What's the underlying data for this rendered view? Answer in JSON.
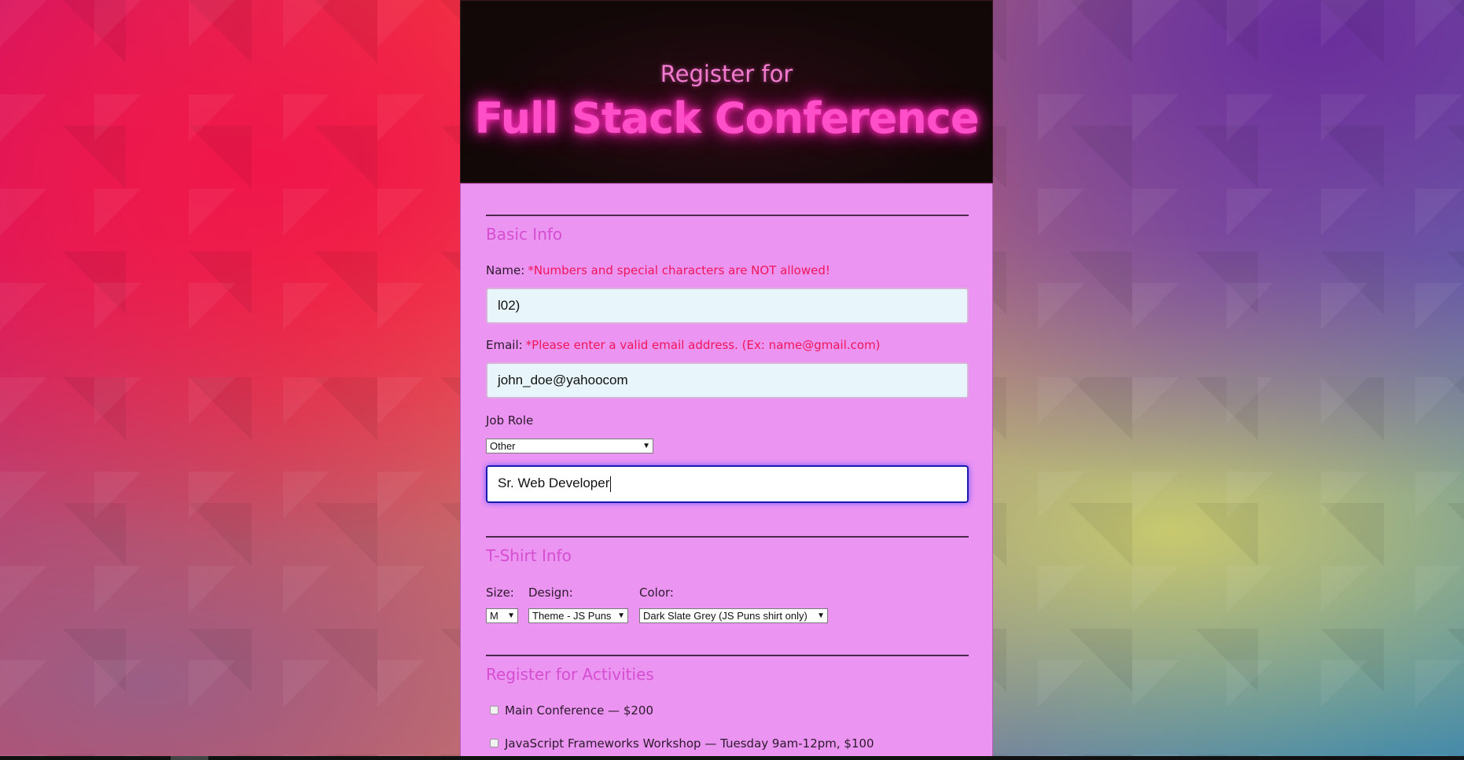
{
  "header": {
    "subtitle": "Register for",
    "title": "Full Stack Conference"
  },
  "basic_info": {
    "title": "Basic Info",
    "name_label": "Name:",
    "name_error": "*Numbers and special characters are NOT allowed!",
    "name_value": "l02)",
    "email_label": "Email:",
    "email_error": "*Please enter a valid email address. (Ex: name@gmail.com)",
    "email_value": "john_doe@yahoocom",
    "job_role_label": "Job Role",
    "job_role_selected": "Other",
    "other_title_value": "Sr. Web Developer"
  },
  "tshirt": {
    "title": "T-Shirt Info",
    "size_label": "Size:",
    "size_selected": "M",
    "design_label": "Design:",
    "design_selected": "Theme - JS Puns",
    "color_label": "Color:",
    "color_selected": "Dark Slate Grey (JS Puns shirt only)"
  },
  "activities": {
    "title": "Register for Activities",
    "items": [
      {
        "label": "Main Conference — $200",
        "checked": false
      },
      {
        "label": "JavaScript Frameworks Workshop — Tuesday 9am-12pm, $100",
        "checked": false
      }
    ]
  },
  "colors": {
    "form_background": "#ec94f2",
    "accent": "#d54ed2",
    "error": "#f0165a",
    "focus_border": "#1a1ab0"
  }
}
